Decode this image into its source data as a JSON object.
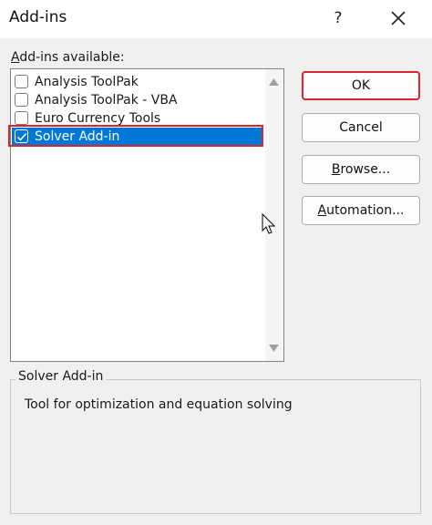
{
  "window": {
    "title": "Add-ins",
    "help_label": "?"
  },
  "addins": {
    "label_prefix": "A",
    "label_rest": "dd-ins available:",
    "items": [
      {
        "label": "Analysis ToolPak",
        "checked": false,
        "selected": false
      },
      {
        "label": "Analysis ToolPak - VBA",
        "checked": false,
        "selected": false
      },
      {
        "label": "Euro Currency Tools",
        "checked": false,
        "selected": false
      },
      {
        "label": "Solver Add-in",
        "checked": true,
        "selected": true
      }
    ]
  },
  "buttons": {
    "ok": "OK",
    "cancel": "Cancel",
    "browse_accel": "B",
    "browse_rest": "rowse...",
    "automation_accel": "A",
    "automation_rest": "utomation..."
  },
  "description": {
    "title": "Solver Add-in",
    "text": "Tool for optimization and equation solving"
  },
  "colors": {
    "selection": "#0078d7",
    "highlight_outline": "#d9252f"
  }
}
